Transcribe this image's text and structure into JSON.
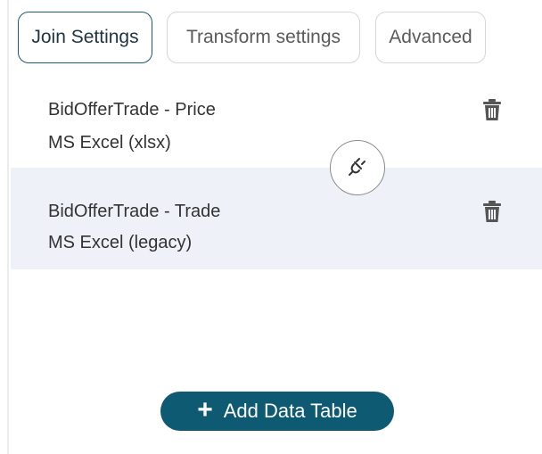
{
  "tabs": [
    {
      "label": "Join Settings",
      "active": true
    },
    {
      "label": "Transform settings",
      "active": false
    },
    {
      "label": "Advanced",
      "active": false
    }
  ],
  "tables": [
    {
      "name": "BidOfferTrade - Price",
      "source": "MS Excel (xlsx)",
      "delete_icon": "trash-icon"
    },
    {
      "name": "BidOfferTrade - Trade",
      "source": "MS Excel (legacy)",
      "delete_icon": "trash-icon"
    }
  ],
  "join_button": {
    "icon": "plug-icon"
  },
  "add_button": {
    "label": "Add Data Table",
    "icon": "plus-icon"
  },
  "colors": {
    "accent": "#0e5a72",
    "active_tab_border": "#1f5b72",
    "selected_row_bg": "#eef1f7",
    "icon": "#555555"
  }
}
